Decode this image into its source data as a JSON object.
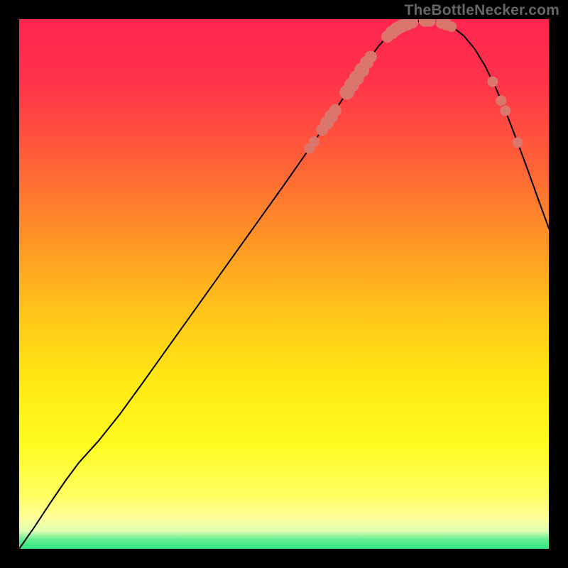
{
  "attribution": "TheBottleNecker.com",
  "chart_data": {
    "type": "line",
    "title": "",
    "xlabel": "",
    "ylabel": "",
    "xlim": [
      0,
      1
    ],
    "ylim": [
      0,
      1
    ],
    "gradient_stops": [
      {
        "offset": 0.0,
        "color": "#ff2550"
      },
      {
        "offset": 0.12,
        "color": "#ff3349"
      },
      {
        "offset": 0.25,
        "color": "#ff5a3a"
      },
      {
        "offset": 0.4,
        "color": "#ff8f27"
      },
      {
        "offset": 0.55,
        "color": "#ffc41a"
      },
      {
        "offset": 0.68,
        "color": "#ffe813"
      },
      {
        "offset": 0.8,
        "color": "#fffb1e"
      },
      {
        "offset": 0.9,
        "color": "#ffff63"
      },
      {
        "offset": 0.94,
        "color": "#ffff97"
      },
      {
        "offset": 0.966,
        "color": "#e2ffb6"
      },
      {
        "offset": 0.982,
        "color": "#66ee90"
      },
      {
        "offset": 1.0,
        "color": "#2fe582"
      }
    ],
    "curve_points": [
      {
        "x": 0.0,
        "y": 0.0
      },
      {
        "x": 0.028,
        "y": 0.04
      },
      {
        "x": 0.057,
        "y": 0.084
      },
      {
        "x": 0.087,
        "y": 0.128
      },
      {
        "x": 0.113,
        "y": 0.163
      },
      {
        "x": 0.15,
        "y": 0.204
      },
      {
        "x": 0.19,
        "y": 0.254
      },
      {
        "x": 0.23,
        "y": 0.309
      },
      {
        "x": 0.27,
        "y": 0.365
      },
      {
        "x": 0.31,
        "y": 0.421
      },
      {
        "x": 0.35,
        "y": 0.477
      },
      {
        "x": 0.39,
        "y": 0.533
      },
      {
        "x": 0.43,
        "y": 0.589
      },
      {
        "x": 0.47,
        "y": 0.645
      },
      {
        "x": 0.5,
        "y": 0.687
      },
      {
        "x": 0.535,
        "y": 0.737
      },
      {
        "x": 0.57,
        "y": 0.788
      },
      {
        "x": 0.6,
        "y": 0.833
      },
      {
        "x": 0.63,
        "y": 0.879
      },
      {
        "x": 0.66,
        "y": 0.924
      },
      {
        "x": 0.68,
        "y": 0.951
      },
      {
        "x": 0.7,
        "y": 0.972
      },
      {
        "x": 0.72,
        "y": 0.986
      },
      {
        "x": 0.74,
        "y": 0.994
      },
      {
        "x": 0.76,
        "y": 0.997
      },
      {
        "x": 0.78,
        "y": 0.997
      },
      {
        "x": 0.8,
        "y": 0.993
      },
      {
        "x": 0.82,
        "y": 0.984
      },
      {
        "x": 0.84,
        "y": 0.968
      },
      {
        "x": 0.86,
        "y": 0.944
      },
      {
        "x": 0.88,
        "y": 0.911
      },
      {
        "x": 0.9,
        "y": 0.87
      },
      {
        "x": 0.92,
        "y": 0.822
      },
      {
        "x": 0.94,
        "y": 0.77
      },
      {
        "x": 0.96,
        "y": 0.716
      },
      {
        "x": 0.98,
        "y": 0.66
      },
      {
        "x": 1.0,
        "y": 0.605
      }
    ],
    "markers": [
      {
        "x": 0.548,
        "y": 0.756,
        "r": 7
      },
      {
        "x": 0.557,
        "y": 0.769,
        "r": 7
      },
      {
        "x": 0.572,
        "y": 0.791,
        "r": 8
      },
      {
        "x": 0.581,
        "y": 0.804,
        "r": 9
      },
      {
        "x": 0.589,
        "y": 0.816,
        "r": 9
      },
      {
        "x": 0.597,
        "y": 0.828,
        "r": 8
      },
      {
        "x": 0.619,
        "y": 0.862,
        "r": 10
      },
      {
        "x": 0.628,
        "y": 0.876,
        "r": 10
      },
      {
        "x": 0.637,
        "y": 0.889,
        "r": 10
      },
      {
        "x": 0.647,
        "y": 0.904,
        "r": 10
      },
      {
        "x": 0.656,
        "y": 0.918,
        "r": 9
      },
      {
        "x": 0.664,
        "y": 0.929,
        "r": 8
      },
      {
        "x": 0.695,
        "y": 0.967,
        "r": 8
      },
      {
        "x": 0.704,
        "y": 0.975,
        "r": 9
      },
      {
        "x": 0.713,
        "y": 0.982,
        "r": 9
      },
      {
        "x": 0.722,
        "y": 0.987,
        "r": 9
      },
      {
        "x": 0.732,
        "y": 0.991,
        "r": 9
      },
      {
        "x": 0.742,
        "y": 0.994,
        "r": 8
      },
      {
        "x": 0.766,
        "y": 0.997,
        "r": 8
      },
      {
        "x": 0.775,
        "y": 0.997,
        "r": 8
      },
      {
        "x": 0.798,
        "y": 0.993,
        "r": 8
      },
      {
        "x": 0.807,
        "y": 0.99,
        "r": 8
      },
      {
        "x": 0.816,
        "y": 0.986,
        "r": 7
      },
      {
        "x": 0.894,
        "y": 0.882,
        "r": 7
      },
      {
        "x": 0.91,
        "y": 0.846,
        "r": 7
      },
      {
        "x": 0.918,
        "y": 0.827,
        "r": 7
      },
      {
        "x": 0.941,
        "y": 0.767,
        "r": 7
      }
    ]
  }
}
